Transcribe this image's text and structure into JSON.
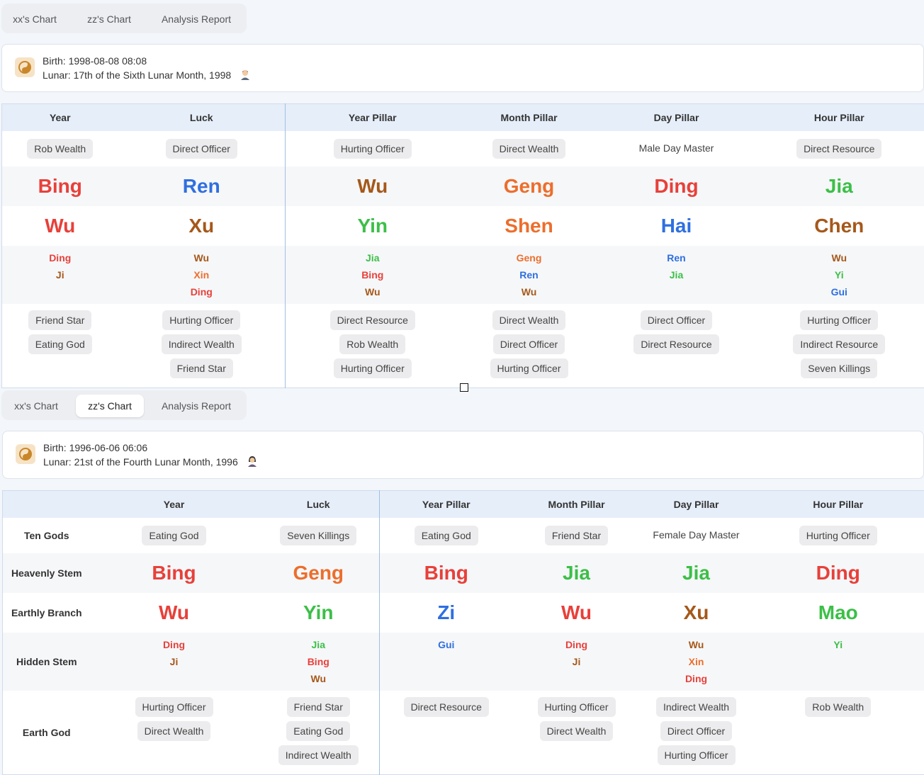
{
  "colors": {
    "fire": "#e8403a",
    "water": "#2f6fe0",
    "earth": "#a5581a",
    "wood": "#3cbf48",
    "metal": "#ec6e2c"
  },
  "charts": [
    {
      "tabs": [
        "xx's Chart",
        "zz's Chart",
        "Analysis Report"
      ],
      "active_tab": 0,
      "birth": "Birth: 1998-08-08 08:08",
      "lunar": "Lunar: 17th of the Sixth Lunar Month, 1998",
      "avatar": "male-avatar-icon",
      "headers": [
        "Year",
        "Luck",
        "Year Pillar",
        "Month Pillar",
        "Day Pillar",
        "Hour Pillar"
      ],
      "row_labels": [
        "",
        "",
        "",
        "",
        ""
      ],
      "ten_gods": [
        {
          "text": "Rob Wealth",
          "pill": true
        },
        {
          "text": "Direct Officer",
          "pill": true
        },
        {
          "text": "Hurting Officer",
          "pill": true
        },
        {
          "text": "Direct Wealth",
          "pill": true
        },
        {
          "text": "Male Day Master",
          "pill": false
        },
        {
          "text": "Direct Resource",
          "pill": true
        }
      ],
      "stems": [
        {
          "text": "Bing",
          "el": "fire"
        },
        {
          "text": "Ren",
          "el": "water"
        },
        {
          "text": "Wu",
          "el": "earth"
        },
        {
          "text": "Geng",
          "el": "metal"
        },
        {
          "text": "Ding",
          "el": "fire"
        },
        {
          "text": "Jia",
          "el": "wood"
        }
      ],
      "branches": [
        {
          "text": "Wu",
          "el": "fire"
        },
        {
          "text": "Xu",
          "el": "earth"
        },
        {
          "text": "Yin",
          "el": "wood"
        },
        {
          "text": "Shen",
          "el": "metal"
        },
        {
          "text": "Hai",
          "el": "water"
        },
        {
          "text": "Chen",
          "el": "earth"
        }
      ],
      "hidden": [
        [
          {
            "text": "Ding",
            "el": "fire"
          },
          {
            "text": "Ji",
            "el": "earth"
          }
        ],
        [
          {
            "text": "Wu",
            "el": "earth"
          },
          {
            "text": "Xin",
            "el": "metal"
          },
          {
            "text": "Ding",
            "el": "fire"
          }
        ],
        [
          {
            "text": "Jia",
            "el": "wood"
          },
          {
            "text": "Bing",
            "el": "fire"
          },
          {
            "text": "Wu",
            "el": "earth"
          }
        ],
        [
          {
            "text": "Geng",
            "el": "metal"
          },
          {
            "text": "Ren",
            "el": "water"
          },
          {
            "text": "Wu",
            "el": "earth"
          }
        ],
        [
          {
            "text": "Ren",
            "el": "water"
          },
          {
            "text": "Jia",
            "el": "wood"
          }
        ],
        [
          {
            "text": "Wu",
            "el": "earth"
          },
          {
            "text": "Yi",
            "el": "wood"
          },
          {
            "text": "Gui",
            "el": "water"
          }
        ]
      ],
      "earth_gods": [
        [
          "Friend Star",
          "Eating God"
        ],
        [
          "Hurting Officer",
          "Indirect Wealth",
          "Friend Star"
        ],
        [
          "Direct Resource",
          "Rob Wealth",
          "Hurting Officer"
        ],
        [
          "Direct Wealth",
          "Direct Officer",
          "Hurting Officer"
        ],
        [
          "Direct Officer",
          "Direct Resource"
        ],
        [
          "Hurting Officer",
          "Indirect Resource",
          "Seven Killings"
        ]
      ]
    },
    {
      "tabs": [
        "xx's Chart",
        "zz's Chart",
        "Analysis Report"
      ],
      "active_tab": 1,
      "birth": "Birth: 1996-06-06 06:06",
      "lunar": "Lunar: 21st of the Fourth Lunar Month, 1996",
      "avatar": "female-avatar-icon",
      "headers": [
        "Year",
        "Luck",
        "Year Pillar",
        "Month Pillar",
        "Day Pillar",
        "Hour Pillar"
      ],
      "row_labels": [
        "Ten Gods",
        "Heavenly Stem",
        "Earthly Branch",
        "Hidden Stem",
        "Earth God"
      ],
      "ten_gods": [
        {
          "text": "Eating God",
          "pill": true
        },
        {
          "text": "Seven Killings",
          "pill": true
        },
        {
          "text": "Eating God",
          "pill": true
        },
        {
          "text": "Friend Star",
          "pill": true
        },
        {
          "text": "Female Day Master",
          "pill": false
        },
        {
          "text": "Hurting Officer",
          "pill": true
        }
      ],
      "stems": [
        {
          "text": "Bing",
          "el": "fire"
        },
        {
          "text": "Geng",
          "el": "metal"
        },
        {
          "text": "Bing",
          "el": "fire"
        },
        {
          "text": "Jia",
          "el": "wood"
        },
        {
          "text": "Jia",
          "el": "wood"
        },
        {
          "text": "Ding",
          "el": "fire"
        }
      ],
      "branches": [
        {
          "text": "Wu",
          "el": "fire"
        },
        {
          "text": "Yin",
          "el": "wood"
        },
        {
          "text": "Zi",
          "el": "water"
        },
        {
          "text": "Wu",
          "el": "fire"
        },
        {
          "text": "Xu",
          "el": "earth"
        },
        {
          "text": "Mao",
          "el": "wood"
        }
      ],
      "hidden": [
        [
          {
            "text": "Ding",
            "el": "fire"
          },
          {
            "text": "Ji",
            "el": "earth"
          }
        ],
        [
          {
            "text": "Jia",
            "el": "wood"
          },
          {
            "text": "Bing",
            "el": "fire"
          },
          {
            "text": "Wu",
            "el": "earth"
          }
        ],
        [
          {
            "text": "Gui",
            "el": "water"
          }
        ],
        [
          {
            "text": "Ding",
            "el": "fire"
          },
          {
            "text": "Ji",
            "el": "earth"
          }
        ],
        [
          {
            "text": "Wu",
            "el": "earth"
          },
          {
            "text": "Xin",
            "el": "metal"
          },
          {
            "text": "Ding",
            "el": "fire"
          }
        ],
        [
          {
            "text": "Yi",
            "el": "wood"
          }
        ]
      ],
      "earth_gods": [
        [
          "Hurting Officer",
          "Direct Wealth"
        ],
        [
          "Friend Star",
          "Eating God",
          "Indirect Wealth"
        ],
        [
          "Direct Resource"
        ],
        [
          "Hurting Officer",
          "Direct Wealth"
        ],
        [
          "Indirect Wealth",
          "Direct Officer",
          "Hurting Officer"
        ],
        [
          "Rob Wealth"
        ]
      ]
    }
  ]
}
